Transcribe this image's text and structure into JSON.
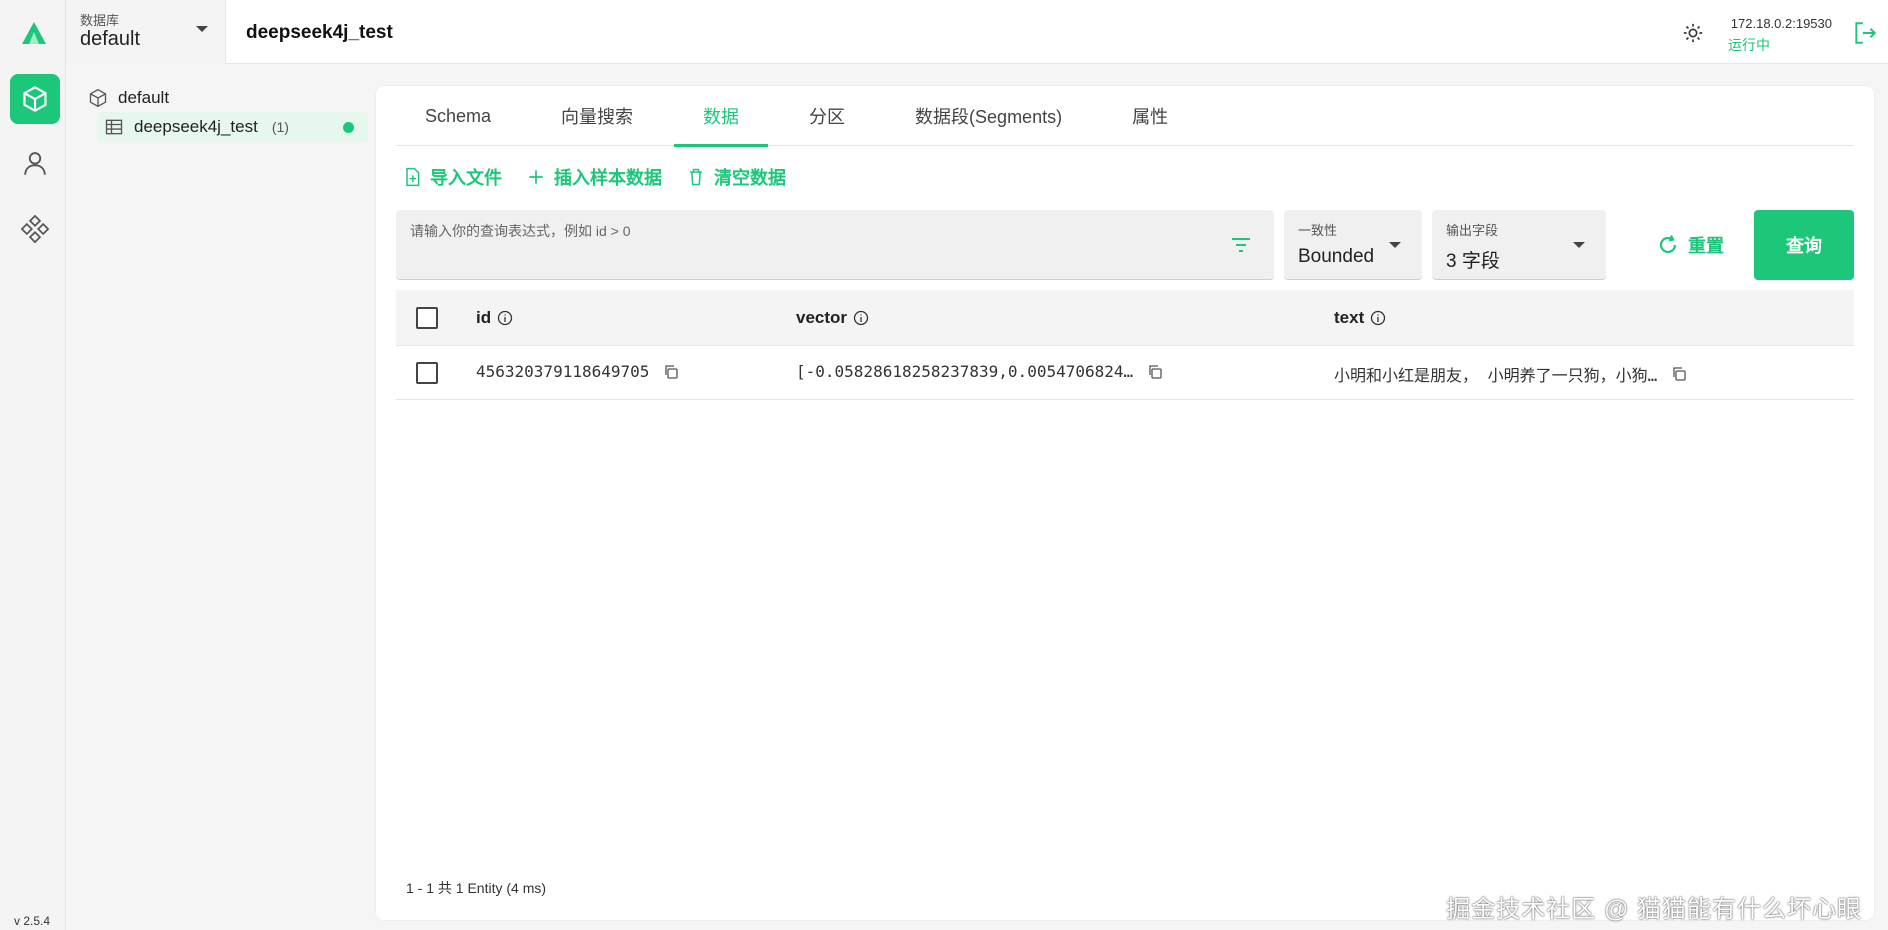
{
  "app": {
    "version": "v 2.5.4"
  },
  "colors": {
    "accent": "#1cc77a"
  },
  "topbar": {
    "db_label": "数据库",
    "db_value": "default",
    "collection_title": "deepseek4j_test",
    "server_address": "172.18.0.2:19530",
    "server_status": "运行中"
  },
  "tree": {
    "database": "default",
    "collection": {
      "name": "deepseek4j_test",
      "count": "(1)"
    }
  },
  "tabs": [
    {
      "label": "Schema"
    },
    {
      "label": "向量搜索"
    },
    {
      "label": "数据",
      "active": true
    },
    {
      "label": "分区"
    },
    {
      "label": "数据段(Segments)"
    },
    {
      "label": "属性"
    }
  ],
  "actions": {
    "import": "导入文件",
    "insert_sample": "插入样本数据",
    "clear": "清空数据"
  },
  "query": {
    "placeholder": "请输入你的查询表达式，例如 id > 0",
    "consistency_label": "一致性",
    "consistency_value": "Bounded",
    "output_label": "输出字段",
    "output_value": "3 字段",
    "reset": "重置",
    "submit": "查询"
  },
  "table": {
    "columns": [
      "id",
      "vector",
      "text"
    ],
    "rows": [
      {
        "id": "456320379118649705",
        "vector": "[-0.05828618258237839,0.0054706824…",
        "text": "小明和小红是朋友， 小明养了一只狗，小狗…"
      }
    ]
  },
  "footer": {
    "summary": "1 - 1  共 1 Entity (4 ms)"
  },
  "watermark": "掘金技术社区 @ 猫猫能有什么坏心眼"
}
